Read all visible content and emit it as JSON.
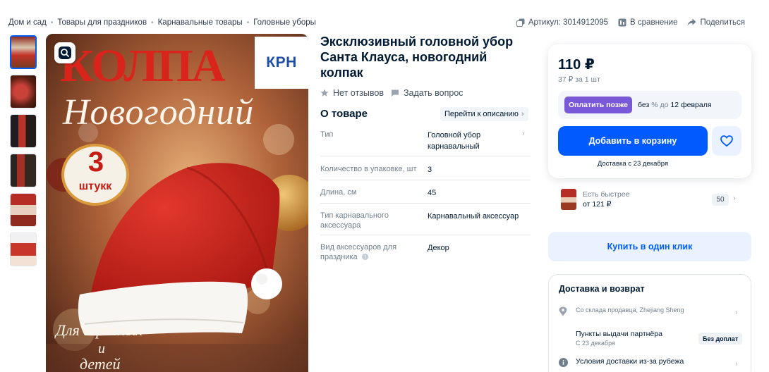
{
  "breadcrumbs": [
    "Дом и сад",
    "Товары для праздников",
    "Карнавальные товары",
    "Головные уборы"
  ],
  "top_actions": {
    "article": "Артикул: 3014912095",
    "compare": "В сравнение",
    "share": "Поделиться"
  },
  "gallery": {
    "thumbnails": [
      "thumb-1",
      "thumb-2",
      "thumb-3",
      "thumb-4",
      "thumb-5",
      "thumb-6"
    ],
    "active_index": 0,
    "main_image": {
      "line1": "КОЛПА",
      "line2": "Новогодний",
      "badge_count": "3",
      "badge_unit": "штукк",
      "bottom_line1": "Для взрослых",
      "bottom_line2": "и",
      "bottom_line3": "детей",
      "brand": "КРН"
    }
  },
  "product": {
    "title": "Эксклюзивный головной убор Санта Клауса, новогодний колпак",
    "reviews": "Нет отзывов",
    "ask": "Задать вопрос",
    "about_title": "О товаре",
    "goto_description": "Перейти к описанию",
    "specs": [
      {
        "key": "Тип",
        "value": "Головной убор карнавальный"
      },
      {
        "key": "Количество в упаковке, шт",
        "value": "3"
      },
      {
        "key": "Длина, см",
        "value": "45"
      },
      {
        "key": "Тип карнавального аксессуара",
        "value": "Карнавальный аксессуар"
      },
      {
        "key": "Вид аксессуаров для праздника",
        "value": "Декор"
      }
    ]
  },
  "buy_box": {
    "price": "110 ₽",
    "unit_price": "37 ₽ за 1 шт",
    "pay_later_button": "Оплатить позже",
    "pay_later_prefix": "без",
    "pay_later_middle": "% до",
    "pay_later_date": "12 февраля",
    "add_to_cart": "Добавить в корзину",
    "delivery_date": "Доставка с 23 декабря"
  },
  "faster": {
    "label": "Есть быстрее",
    "price": "от 121 ₽",
    "count": "50"
  },
  "one_click": "Купить в один клик",
  "delivery": {
    "title": "Доставка и возврат",
    "warehouse_sub": "Со склада продавца, Zhejiang Sheng",
    "pickup_main": "Пункты выдачи партнёра",
    "pickup_sub": "С 23 декабря",
    "pickup_badge": "Без доплат",
    "abroad": "Условия доставки из-за рубежа"
  },
  "colors": {
    "accent": "#005bff",
    "pay_later": "#7a59d9",
    "text": "#001a34",
    "muted": "#707f8d"
  }
}
